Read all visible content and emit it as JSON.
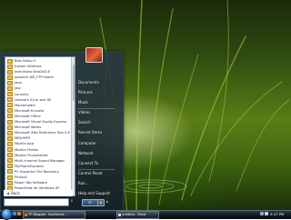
{
  "programs": [
    "Bow Setup 9",
    "Instant Wireless",
    "InterVideo WinDVD 8",
    "Ipswitch WS_FTP Home",
    "Java",
    "Jasc",
    "Launchy",
    "Lexmark All-in-one SE",
    "Macromedia",
    "Microsoft Encarta",
    "Microsoft Office",
    "Microsoft Visual Studio Express",
    "Microsoft Works",
    "Microsoft XNA Reference Tool 0.8",
    "MIDI/MP3",
    "Mozilla App",
    "Mozilla Firefox",
    "Mozilla Thunderbird",
    "Multi-channel Sound Manager",
    "MyPhoneExplorer",
    "PC Inspector File Recovery",
    "Picasa2",
    "Power Tab Software",
    "PowerShot for Windows XP",
    "PrPlatf edition"
  ],
  "back_label": "Back",
  "right_pane": {
    "documents": "Documents",
    "pictures": "Pictures",
    "music": "Music",
    "videos": "Videos",
    "search": "Search",
    "recent_items": "Recent Items",
    "computer": "Computer",
    "network": "Network",
    "connect_to": "Connect To",
    "control_panel": "Control Panel",
    "run": "Run...",
    "help_support": "Help and Support"
  },
  "taskbar": {
    "button1": "TP Blogger: Sushiland...",
    "button2": "untitled - Paint",
    "clock": "5:47 PM"
  },
  "colors": {
    "wallpaper_green": "#5a7d16",
    "start_orb": "#2a73b8",
    "taskbar": "#0f151b"
  }
}
